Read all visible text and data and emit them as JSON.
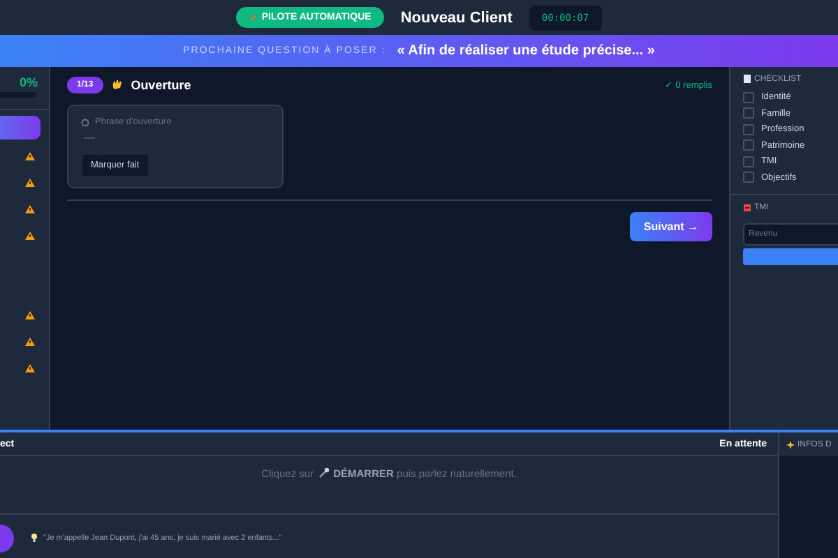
{
  "header": {
    "mode_badge": "PILOTE AUTOMATIQUE",
    "title": "Nouveau Client",
    "timer": "00:00:07"
  },
  "banner": {
    "label": "PROCHAINE QUESTION À POSER :",
    "question": "« Afin de réaliser une étude précise... »"
  },
  "progress": {
    "percent": "0%",
    "level": 0
  },
  "steps": [
    {
      "selected": true,
      "warning": false
    },
    {
      "selected": false,
      "warning": true
    },
    {
      "selected": false,
      "warning": true
    },
    {
      "selected": false,
      "warning": true
    },
    {
      "selected": false,
      "warning": true
    },
    {
      "selected": false,
      "warning": false
    },
    {
      "selected": false,
      "warning": false
    },
    {
      "selected": false,
      "warning": true
    },
    {
      "selected": false,
      "warning": true
    },
    {
      "selected": false,
      "warning": true
    }
  ],
  "step": {
    "counter": "1/13",
    "title": "Ouverture",
    "filled": "✓ 0 remplis",
    "card": {
      "label": "Phrase d'ouverture",
      "value": "—",
      "button": "Marquer fait"
    },
    "next_button": "Suivant →"
  },
  "checklist": {
    "title": "CHECKLIST",
    "items": [
      {
        "label": "Identité",
        "checked": false
      },
      {
        "label": "Famille",
        "checked": false
      },
      {
        "label": "Profession",
        "checked": false
      },
      {
        "label": "Patrimoine",
        "checked": false
      },
      {
        "label": "TMI",
        "checked": false
      },
      {
        "label": "Objectifs",
        "checked": false
      }
    ]
  },
  "tmi": {
    "title": "TMI",
    "placeholder": "Revenu"
  },
  "transcript": {
    "title": "ect",
    "status": "En attente",
    "hint_before": "Cliquez sur",
    "hint_after": "**DÉMARRER** puis parlez naturellement.",
    "example": "\"Je m'appelle Jean Dupont, j'ai 45 ans, je suis marié avec 2 enfants...\""
  },
  "info_panel": {
    "title": "INFOS D"
  }
}
